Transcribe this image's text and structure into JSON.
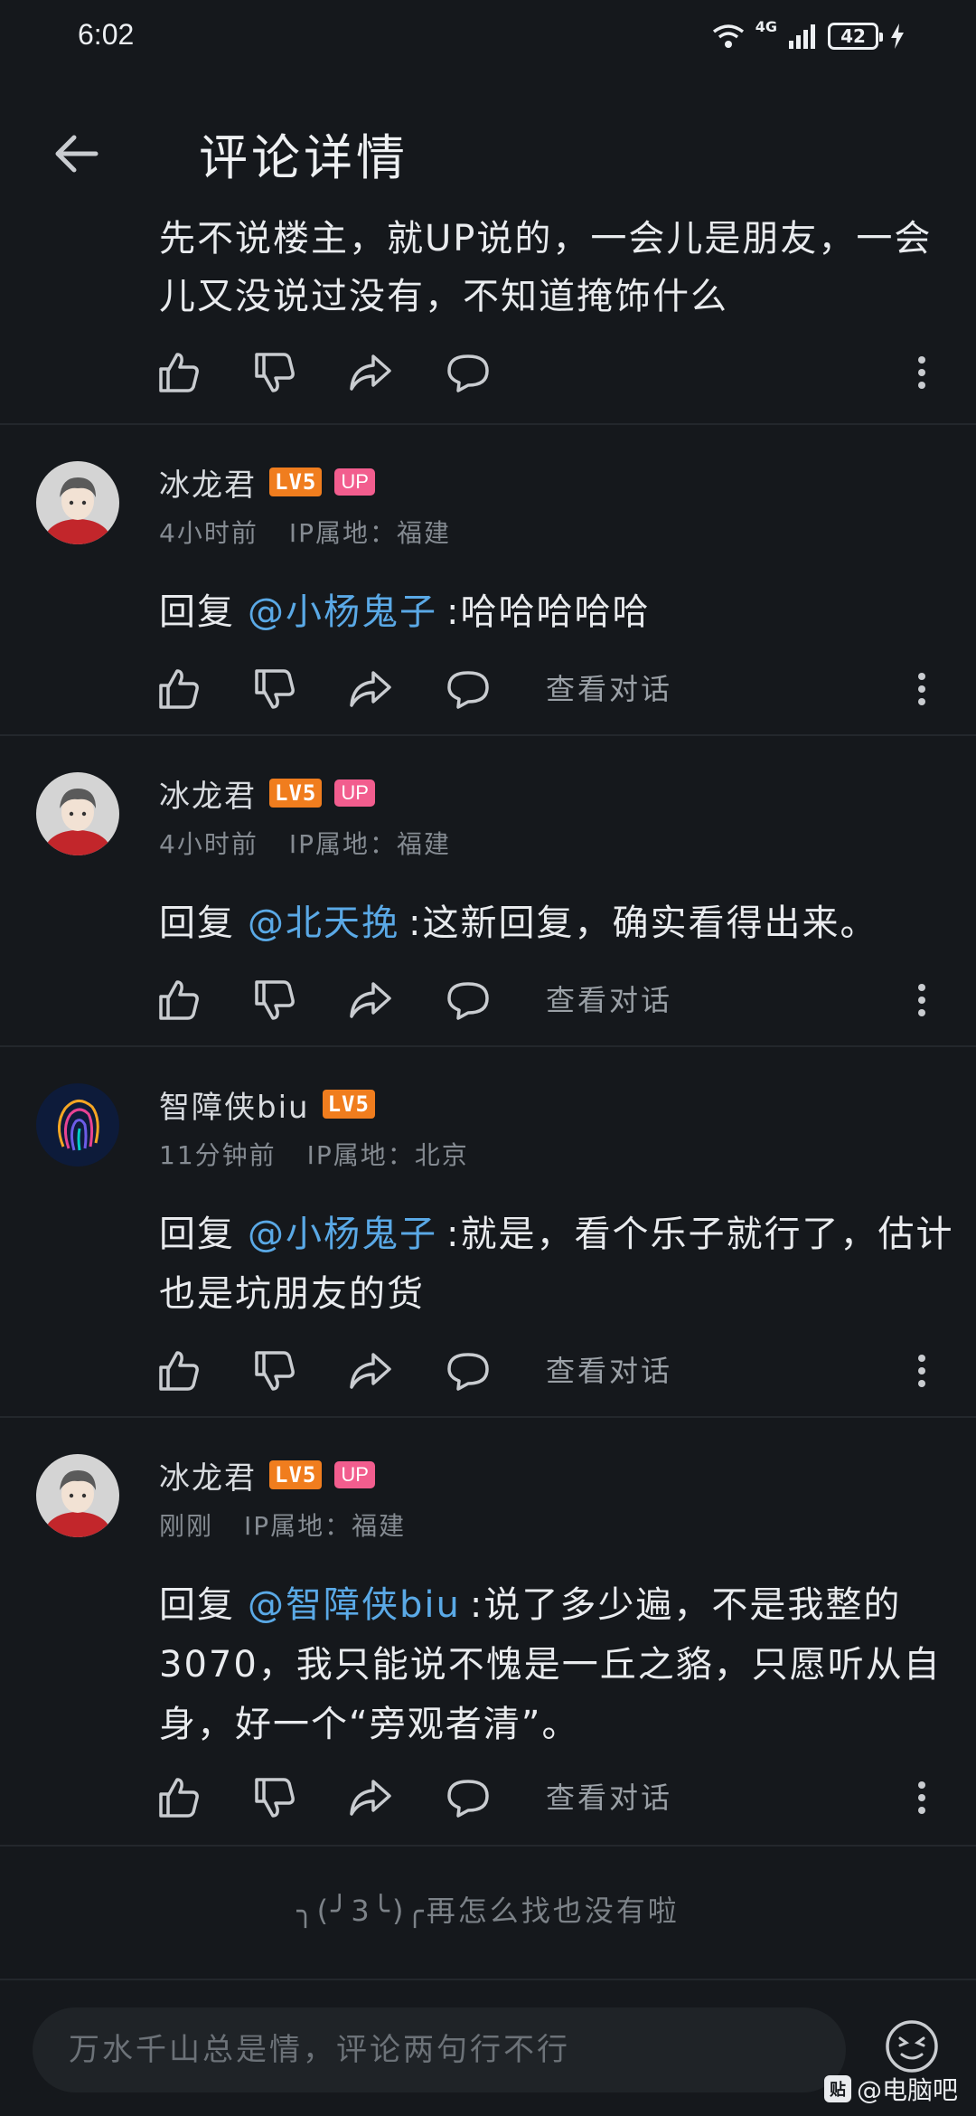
{
  "status_bar": {
    "time": "6:02",
    "network": "4G",
    "battery": "42"
  },
  "header": {
    "title": "评论详情"
  },
  "first_comment": {
    "text": "先不说楼主，就UP说的，一会儿是朋友，一会儿又没说过没有，不知道掩饰什么"
  },
  "comments": [
    {
      "username": "冰龙君",
      "level": "LV5",
      "up_badge": "UP",
      "time": "4小时前",
      "ip": "IP属地：福建",
      "reply_prefix": "回复",
      "mention": "@小杨鬼子",
      "text": ":哈哈哈哈哈",
      "view_conversation": "查看对话"
    },
    {
      "username": "冰龙君",
      "level": "LV5",
      "up_badge": "UP",
      "time": "4小时前",
      "ip": "IP属地：福建",
      "reply_prefix": "回复",
      "mention": "@北天挽",
      "text": ":这新回复，确实看得出来。",
      "view_conversation": "查看对话"
    },
    {
      "username": "智障侠biu",
      "level": "LV5",
      "time": "11分钟前",
      "ip": "IP属地：北京",
      "reply_prefix": "回复",
      "mention": "@小杨鬼子",
      "text": ":就是，看个乐子就行了，估计也是坑朋友的货",
      "view_conversation": "查看对话"
    },
    {
      "username": "冰龙君",
      "level": "LV5",
      "up_badge": "UP",
      "time": "刚刚",
      "ip": "IP属地：福建",
      "reply_prefix": "回复",
      "mention": "@智障侠biu",
      "text": ":说了多少遍，不是我整的3070，我只能说不愧是一丘之貉，只愿听从自身，好一个“旁观者清”。",
      "view_conversation": "查看对话"
    }
  ],
  "end_text": "╮(╯3╰)╭再怎么找也没有啦",
  "input": {
    "placeholder": "万水千山总是情，评论两句行不行"
  },
  "watermark": {
    "logo": "贴",
    "text": "@电脑吧"
  },
  "colors": {
    "background": "#15181c",
    "mention": "#5aa9e6",
    "level_badge": "#f07d1e",
    "up_badge": "#f25d8e"
  }
}
